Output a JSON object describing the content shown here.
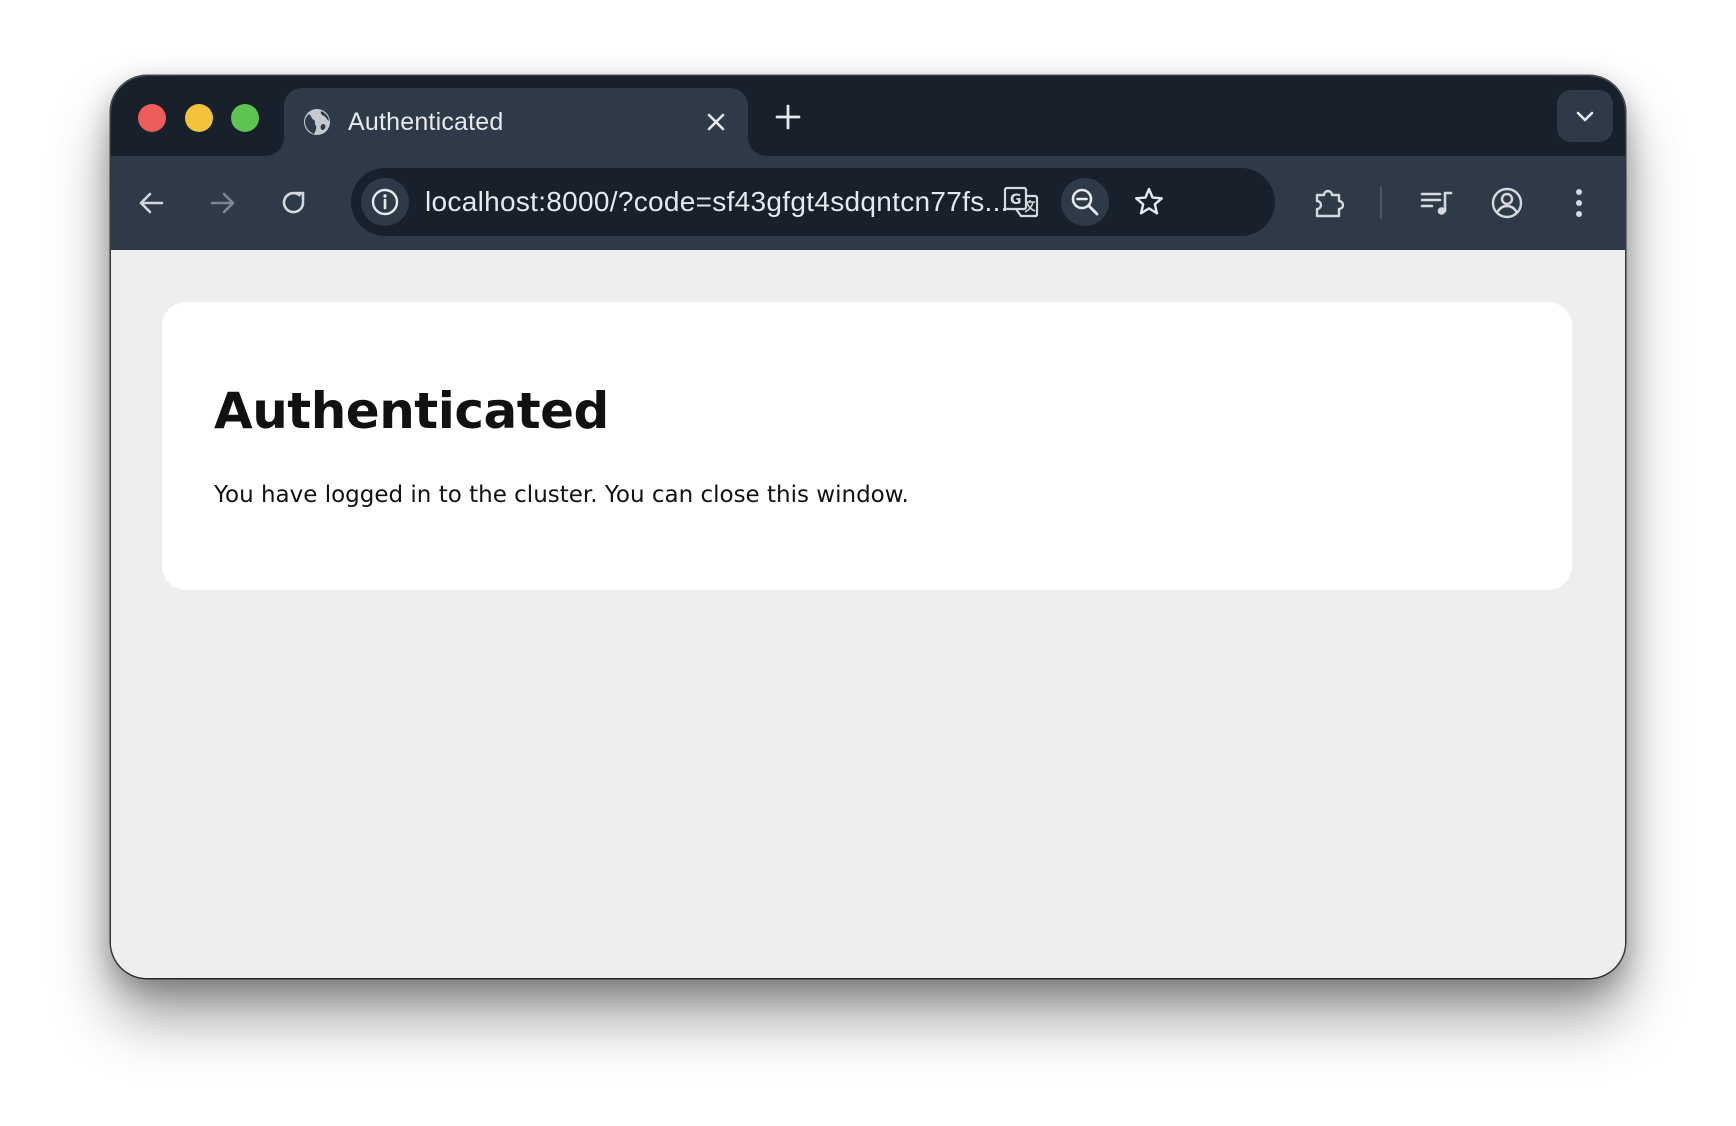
{
  "window": {
    "controls": [
      "close",
      "minimize",
      "maximize"
    ]
  },
  "tab": {
    "title": "Authenticated",
    "favicon": "globe-icon",
    "close_icon": "close-icon"
  },
  "tabbar": {
    "new_tab_icon": "plus-icon",
    "tab_search_icon": "chevron-down-icon"
  },
  "toolbar": {
    "back_icon": "arrow-left-icon",
    "forward_icon": "arrow-right-icon",
    "reload_icon": "reload-icon",
    "url": "localhost:8000/?code=sf43gfgt4sdqntcn77fs...",
    "site_info_icon": "info-icon",
    "translate_icon": "translate-icon",
    "zoom_icon": "zoom-out-icon",
    "bookmark_icon": "star-icon",
    "extensions_icon": "puzzle-icon",
    "media_icon": "playlist-icon",
    "profile_icon": "account-icon",
    "menu_icon": "kebab-menu-icon"
  },
  "page": {
    "heading": "Authenticated",
    "message": "You have logged in to the cluster. You can close this window."
  },
  "colors": {
    "tabbar_bg": "#17202b",
    "toolbar_bg": "#2e3a47",
    "page_bg": "#eeeeee",
    "card_bg": "#ffffff"
  }
}
